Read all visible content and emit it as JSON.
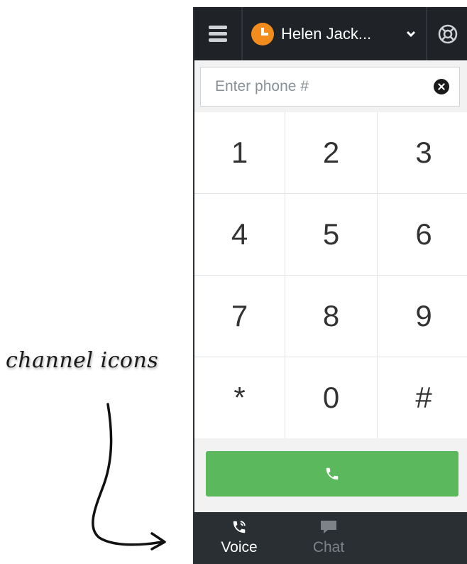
{
  "annotation": {
    "text": "channel icons"
  },
  "header": {
    "menu_icon": "hamburger-menu-icon",
    "agent_name": "Helen Jack...",
    "status_color": "#f28c1c",
    "dropdown_icon": "chevron-down-icon",
    "help_icon": "support-icon"
  },
  "dialer": {
    "input_placeholder": "Enter phone #",
    "input_value": "",
    "clear_icon": "clear-icon"
  },
  "keypad": {
    "keys": [
      "1",
      "2",
      "3",
      "4",
      "5",
      "6",
      "7",
      "8",
      "9",
      "*",
      "0",
      "#"
    ]
  },
  "call_button": {
    "icon": "phone-icon",
    "color": "#5cb85c"
  },
  "channels": [
    {
      "label": "Voice",
      "icon": "voice-icon",
      "active": true
    },
    {
      "label": "Chat",
      "icon": "chat-icon",
      "active": false
    }
  ]
}
